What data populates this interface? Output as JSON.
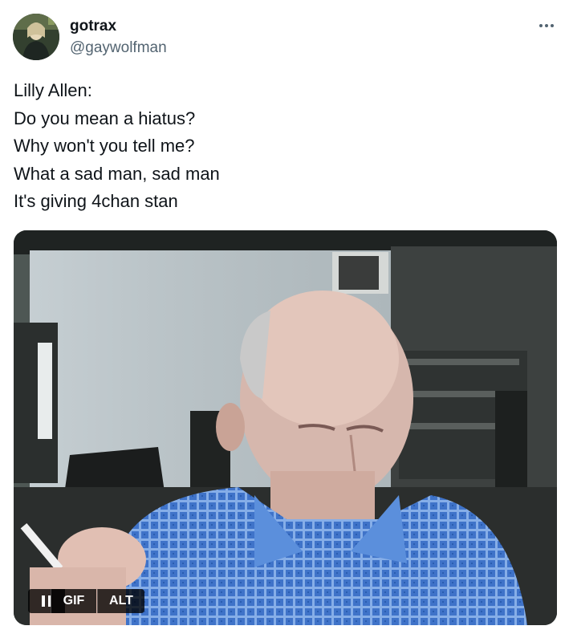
{
  "author": {
    "display_name": "gotrax",
    "handle": "@gaywolfman",
    "avatar_icon": "user-avatar"
  },
  "menu": {
    "icon": "more-horizontal-icon"
  },
  "tweet": {
    "lines": [
      "Lilly Allen:",
      "Do you mean a hiatus?",
      "Why won't you tell me?",
      "What a sad man, sad man",
      "It's giving 4chan stan"
    ]
  },
  "media": {
    "type": "gif",
    "pause_icon": "pause-icon",
    "gif_label": "GIF",
    "alt_label": "ALT"
  },
  "colors": {
    "text_primary": "#0f1419",
    "text_secondary": "#536471",
    "background": "#ffffff",
    "badge_bg": "#000000"
  }
}
